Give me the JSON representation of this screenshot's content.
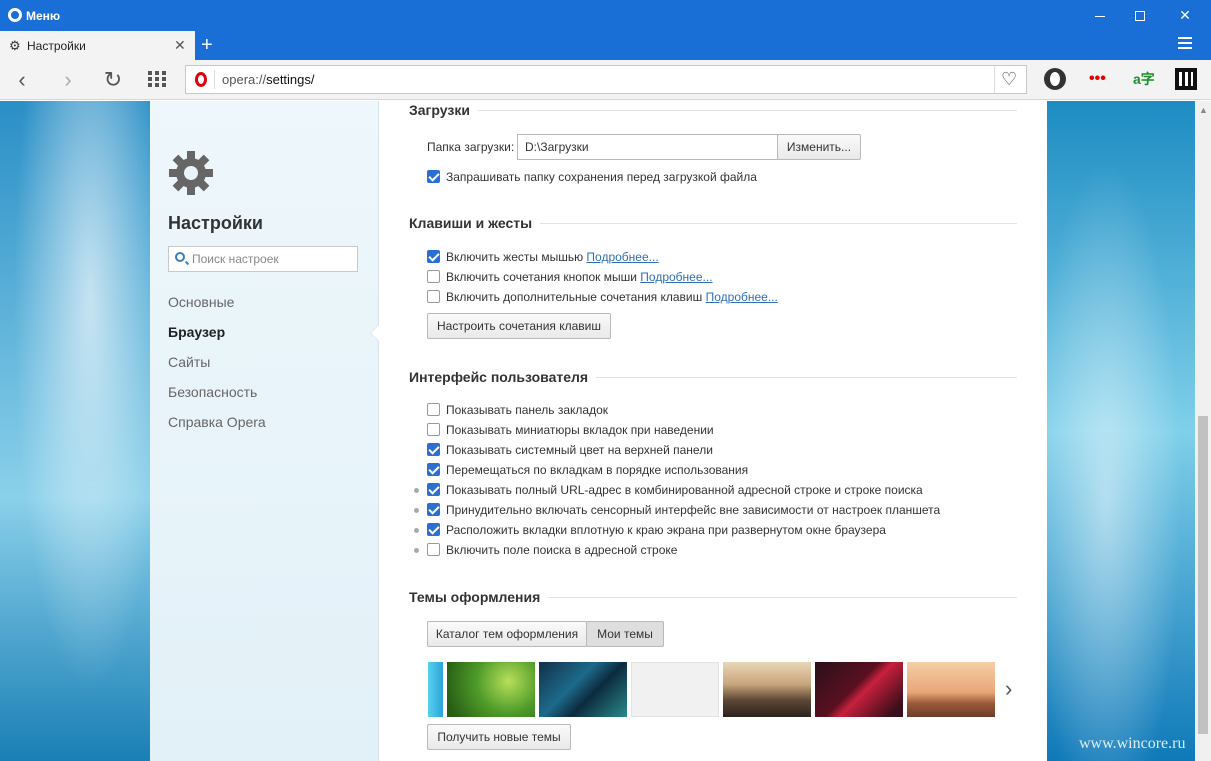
{
  "window": {
    "title": "Меню",
    "controls": {
      "min": "",
      "max": "",
      "close": "✕"
    }
  },
  "tabs": [
    {
      "label": "Настройки",
      "icon": "gear-icon",
      "close": "✕"
    }
  ],
  "newtab_label": "+",
  "address": {
    "scheme": "opera://",
    "path": "settings/",
    "heart": "♡"
  },
  "nav": {
    "back": "‹",
    "forward": "›",
    "reload": "↻"
  },
  "extensions": {
    "ext2": "•••",
    "ext3": "a字"
  },
  "sidebar": {
    "title": "Настройки",
    "search_placeholder": "Поиск настроек",
    "items": [
      {
        "label": "Основные",
        "active": false
      },
      {
        "label": "Браузер",
        "active": true
      },
      {
        "label": "Сайты",
        "active": false
      },
      {
        "label": "Безопасность",
        "active": false
      },
      {
        "label": "Справка Opera",
        "active": false
      }
    ]
  },
  "sections": {
    "downloads": {
      "title": "Загрузки",
      "folder_label": "Папка загрузки:",
      "folder_value": "D:\\Загрузки",
      "change_button": "Изменить...",
      "ask_label": "Запрашивать папку сохранения перед загрузкой файла",
      "ask_checked": true
    },
    "keys": {
      "title": "Клавиши и жесты",
      "items": [
        {
          "label": "Включить жесты мышью",
          "link": "Подробнее...",
          "checked": true
        },
        {
          "label": "Включить сочетания кнопок мыши",
          "link": "Подробнее...",
          "checked": false
        },
        {
          "label": "Включить дополнительные сочетания клавиш",
          "link": "Подробнее...",
          "checked": false
        }
      ],
      "configure_button": "Настроить сочетания клавиш"
    },
    "ui": {
      "title": "Интерфейс пользователя",
      "items": [
        {
          "label": "Показывать панель закладок",
          "checked": false,
          "dot": false
        },
        {
          "label": "Показывать миниатюры вкладок при наведении",
          "checked": false,
          "dot": false
        },
        {
          "label": "Показывать системный цвет на верхней панели",
          "checked": true,
          "dot": false
        },
        {
          "label": "Перемещаться по вкладкам в порядке использования",
          "checked": true,
          "dot": false
        },
        {
          "label": "Показывать полный URL-адрес в комбинированной адресной строке и строке поиска",
          "checked": true,
          "dot": true
        },
        {
          "label": "Принудительно включать сенсорный интерфейс вне зависимости от настроек планшета",
          "checked": true,
          "dot": true
        },
        {
          "label": "Расположить вкладки вплотную к краю экрана при развернутом окне браузера",
          "checked": true,
          "dot": true
        },
        {
          "label": "Включить поле поиска в адресной строке",
          "checked": false,
          "dot": true
        }
      ]
    },
    "themes": {
      "title": "Темы оформления",
      "tab_catalog": "Каталог тем оформления",
      "tab_mine": "Мои темы",
      "prev": "‹",
      "next": "›",
      "get_button": "Получить новые темы"
    }
  },
  "watermark": "www.wincore.ru",
  "colors": {
    "accent": "#1a6fd6",
    "checkbox": "#2a6fd1",
    "link": "#2f6fb6"
  }
}
